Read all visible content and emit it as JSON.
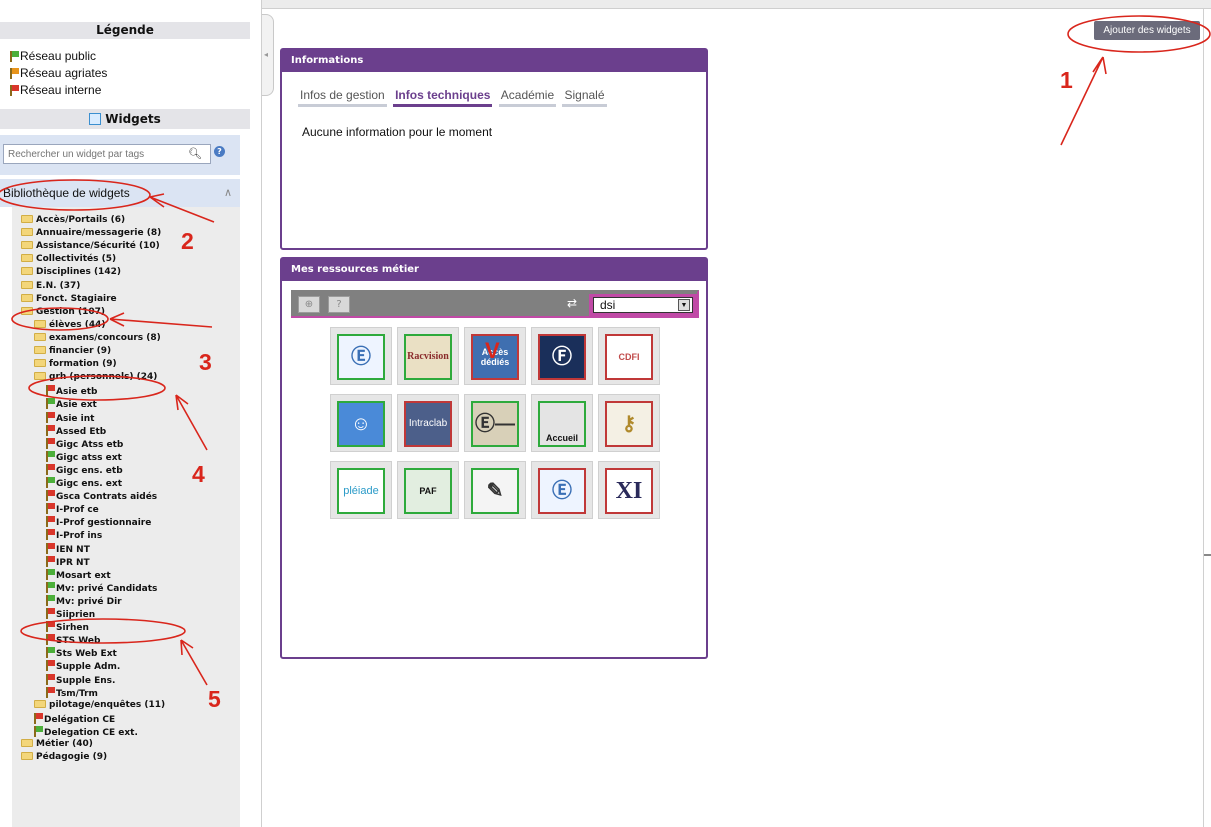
{
  "legend": {
    "title": "Légende",
    "items": [
      {
        "label": "Réseau public",
        "color": "#4caf3a",
        "icon": "green-flag-icon"
      },
      {
        "label": "Réseau agriates",
        "color": "#e8941a",
        "icon": "orange-flag-icon"
      },
      {
        "label": "Réseau interne",
        "color": "#d9362b",
        "icon": "red-flag-icon"
      }
    ]
  },
  "widgets": {
    "title": "Widgets",
    "search_placeholder": "Rechercher un widget par tags",
    "library_label": "Bibliothèque de widgets"
  },
  "tree": [
    {
      "label": "Accès/Portails (6)",
      "type": "folder",
      "level": 0
    },
    {
      "label": "Annuaire/messagerie (8)",
      "type": "folder",
      "level": 0
    },
    {
      "label": "Assistance/Sécurité (10)",
      "type": "folder",
      "level": 0
    },
    {
      "label": "Collectivités (5)",
      "type": "folder",
      "level": 0
    },
    {
      "label": "Disciplines (142)",
      "type": "folder",
      "level": 0
    },
    {
      "label": "E.N. (37)",
      "type": "folder",
      "level": 0
    },
    {
      "label": "Fonct. Stagiaire",
      "type": "folder",
      "level": 0
    },
    {
      "label": "Gestion (107)",
      "type": "folder",
      "level": 0
    },
    {
      "label": "élèves (44)",
      "type": "folder",
      "level": 1
    },
    {
      "label": "examens/concours (8)",
      "type": "folder",
      "level": 1
    },
    {
      "label": "financier (9)",
      "type": "folder",
      "level": 1
    },
    {
      "label": "formation (9)",
      "type": "folder",
      "level": 1
    },
    {
      "label": "grh (personnels) (24)",
      "type": "folder",
      "level": 1
    },
    {
      "label": "Asie etb",
      "type": "widget",
      "level": 2,
      "color": "#d9362b"
    },
    {
      "label": "Asie ext",
      "type": "widget",
      "level": 2,
      "color": "#4caf3a"
    },
    {
      "label": "Asie int",
      "type": "widget",
      "level": 2,
      "color": "#d9362b"
    },
    {
      "label": "Assed Etb",
      "type": "widget",
      "level": 2,
      "color": "#d9362b"
    },
    {
      "label": "Gigc Atss etb",
      "type": "widget",
      "level": 2,
      "color": "#d9362b"
    },
    {
      "label": "Gigc atss ext",
      "type": "widget",
      "level": 2,
      "color": "#4caf3a"
    },
    {
      "label": "Gigc ens. etb",
      "type": "widget",
      "level": 2,
      "color": "#d9362b"
    },
    {
      "label": "Gigc ens. ext",
      "type": "widget",
      "level": 2,
      "color": "#4caf3a"
    },
    {
      "label": "Gsca Contrats aidés",
      "type": "widget",
      "level": 2,
      "color": "#d9362b"
    },
    {
      "label": "I-Prof ce",
      "type": "widget",
      "level": 2,
      "color": "#d9362b"
    },
    {
      "label": "I-Prof gestionnaire",
      "type": "widget",
      "level": 2,
      "color": "#d9362b"
    },
    {
      "label": "I-Prof ins",
      "type": "widget",
      "level": 2,
      "color": "#d9362b"
    },
    {
      "label": "IEN NT",
      "type": "widget",
      "level": 2,
      "color": "#d9362b"
    },
    {
      "label": "IPR NT",
      "type": "widget",
      "level": 2,
      "color": "#d9362b"
    },
    {
      "label": "Mosart ext",
      "type": "widget",
      "level": 2,
      "color": "#4caf3a"
    },
    {
      "label": "Mv: privé Candidats",
      "type": "widget",
      "level": 2,
      "color": "#4caf3a"
    },
    {
      "label": "Mv: privé Dir",
      "type": "widget",
      "level": 2,
      "color": "#4caf3a"
    },
    {
      "label": "Siiprien",
      "type": "widget",
      "level": 2,
      "color": "#d9362b"
    },
    {
      "label": "Sirhen",
      "type": "widget",
      "level": 2,
      "color": "#d9362b"
    },
    {
      "label": "STS Web",
      "type": "widget",
      "level": 2,
      "color": "#d9362b"
    },
    {
      "label": "Sts Web Ext",
      "type": "widget",
      "level": 2,
      "color": "#4caf3a"
    },
    {
      "label": "Supple Adm.",
      "type": "widget",
      "level": 2,
      "color": "#d9362b"
    },
    {
      "label": "Supple Ens.",
      "type": "widget",
      "level": 2,
      "color": "#d9362b"
    },
    {
      "label": "Tsm/Trm",
      "type": "widget",
      "level": 2,
      "color": "#d9362b"
    },
    {
      "label": "pilotage/enquêtes (11)",
      "type": "folder",
      "level": 1
    },
    {
      "label": "Delégation CE",
      "type": "widget",
      "level": 1,
      "color": "#d9362b"
    },
    {
      "label": "Delegation CE ext.",
      "type": "widget",
      "level": 1,
      "color": "#4caf3a"
    },
    {
      "label": "Métier (40)",
      "type": "folder",
      "level": 0
    },
    {
      "label": "Pédagogie (9)",
      "type": "folder",
      "level": 0
    }
  ],
  "header": {
    "add_widgets_label": "Ajouter des widgets"
  },
  "info_panel": {
    "title": "Informations",
    "tabs": [
      {
        "label": "Infos de gestion",
        "active": false
      },
      {
        "label": "Infos techniques",
        "active": true
      },
      {
        "label": "Académie",
        "active": false
      },
      {
        "label": "Signalé",
        "active": false
      }
    ],
    "message": "Aucune information pour le moment"
  },
  "resources_panel": {
    "title": "Mes ressources métier",
    "selected_profile": "dsi",
    "tiles": [
      {
        "label": "",
        "name": "tile-ministere-1",
        "border": "#2eaa3c",
        "bg": "#eef4ff",
        "icon": "ministry-logo-icon",
        "text_color": "#3a6fb5"
      },
      {
        "label": "Racvision",
        "name": "tile-racvision",
        "border": "#2eaa3c",
        "bg": "#eae0c4",
        "icon": "",
        "text_color": "#8b2c2c"
      },
      {
        "label": "Accès dédiés",
        "name": "tile-acces-dedies",
        "border": "#c03838",
        "bg": "#3f6fb0",
        "icon": "",
        "text_color": "#ffffff"
      },
      {
        "label": "",
        "name": "tile-f-logo",
        "border": "#c03838",
        "bg": "#1a2f5a",
        "icon": "f-circle-logo-icon",
        "text_color": "#ffffff"
      },
      {
        "label": "CDFI",
        "name": "tile-cdfi",
        "border": "#c03838",
        "bg": "#ffffff",
        "icon": "",
        "text_color": "#c04a4a"
      },
      {
        "label": "",
        "name": "tile-cartoon",
        "border": "#2eaa3c",
        "bg": "#4a8ad8",
        "icon": "cartoon-character-icon",
        "text_color": "#ffffff"
      },
      {
        "label": "Intraclab",
        "name": "tile-intraclab",
        "border": "#c03838",
        "bg": "#4c5f8a",
        "icon": "",
        "text_color": "#ffffff"
      },
      {
        "label": "",
        "name": "tile-e-logo",
        "border": "#2eaa3c",
        "bg": "#d8d0b8",
        "icon": "e-circle-logo-icon",
        "text_color": "#333"
      },
      {
        "label": "Accueil",
        "name": "tile-accueil",
        "border": "#2eaa3c",
        "bg": "#e4e4e4",
        "icon": "",
        "text_color": "#111111"
      },
      {
        "label": "",
        "name": "tile-keys",
        "border": "#c03838",
        "bg": "#f4f0e4",
        "icon": "keys-icon",
        "text_color": "#b08a2c"
      },
      {
        "label": "pléiade",
        "name": "tile-pleiade",
        "border": "#2eaa3c",
        "bg": "#ffffff",
        "icon": "",
        "text_color": "#2b9bc8"
      },
      {
        "label": "PAF",
        "name": "tile-paf",
        "border": "#2eaa3c",
        "bg": "#e2eee0",
        "icon": "",
        "text_color": "#111111"
      },
      {
        "label": "",
        "name": "tile-chat",
        "border": "#2eaa3c",
        "bg": "#f4f4f4",
        "icon": "chat-edit-icon",
        "text_color": "#333"
      },
      {
        "label": "",
        "name": "tile-ministere-2",
        "border": "#c03838",
        "bg": "#eef4ff",
        "icon": "ministry-logo-icon",
        "text_color": "#3a6fb5"
      },
      {
        "label": "XI",
        "name": "tile-xi",
        "border": "#c03838",
        "bg": "#ffffff",
        "icon": "",
        "text_color": "#2a2a5a"
      }
    ]
  },
  "annotations": {
    "numbers": [
      "1",
      "2",
      "3",
      "4",
      "5"
    ],
    "color": "#d9261c"
  }
}
